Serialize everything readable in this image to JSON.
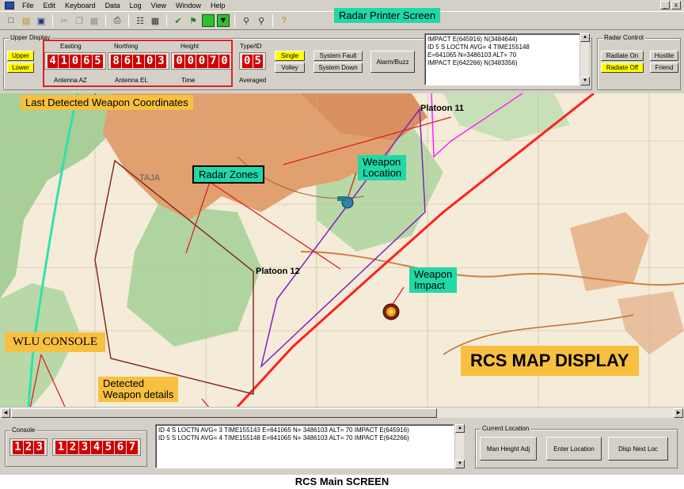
{
  "menu": [
    "File",
    "Edit",
    "Keyboard",
    "Data",
    "Log",
    "View",
    "Window",
    "Help"
  ],
  "window_buttons": [
    "_",
    "x"
  ],
  "toolbar_icons": [
    "new-file-icon",
    "open-folder-icon",
    "save-icon",
    "cut-icon",
    "copy-icon",
    "paste-icon",
    "print-icon",
    "page-icon",
    "calculator-icon",
    "checkmark-icon",
    "flag-icon",
    "map-icon",
    "grid-icon",
    "zoom-in-icon",
    "zoom-out-icon",
    "help-icon"
  ],
  "upper_display": {
    "title": "Upper Display",
    "upper_label": "Upper",
    "lower_label": "Lower",
    "easting_label": "Easting",
    "northing_label": "Northing",
    "height_label": "Height",
    "typeid_label": "Type/ID",
    "easting": [
      "4",
      "1",
      "0",
      "6",
      "5"
    ],
    "northing": [
      "8",
      "6",
      "1",
      "0",
      "3"
    ],
    "height": [
      "0",
      "0",
      "0",
      "7",
      "0"
    ],
    "typeid": [
      "0",
      "5"
    ],
    "antenna_az_label": "Antenna AZ",
    "antenna_el_label": "Antenna EL",
    "time_label": "Time",
    "averaged_label": "Averaged",
    "single_label": "Single",
    "volley_label": "Volley",
    "system_fault_label": "System Fault",
    "system_down_label": "System Down",
    "alarm_label": "Alarm/Buzz"
  },
  "printer": {
    "lines": [
      "IMPACT  E(645916) N(3484644)",
      "ID 5  S LOCTN AVG= 4  TIME155148",
      "E=641065  N=3486103  ALT=  70",
      "IMPACT  E(642266) N(3483356)"
    ]
  },
  "radar_control": {
    "title": "Radar Control",
    "radiate_on": "Radiate On",
    "radiate_off": "Radiate Off",
    "hostile": "Hostile",
    "friend": "Friend"
  },
  "map": {
    "grid_label": "TAJA",
    "platoon_11": "Platoon 11",
    "platoon_12": "Platoon 12"
  },
  "callouts": {
    "radar_printer": "Radar Printer Screen",
    "last_detected": "Last Detected Weapon Coordinates",
    "radar_zones": "Radar Zones",
    "weapon_location_1": "Weapon",
    "weapon_location_2": "Location",
    "weapon_impact_1": "Weapon",
    "weapon_impact_2": "Impact",
    "wlu_console": "WLU CONSOLE",
    "detected_1": "Detected",
    "detected_2": "Weapon details",
    "rcs_map": "RCS MAP DISPLAY"
  },
  "console": {
    "title": "Console",
    "short": [
      "1",
      "2",
      "3"
    ],
    "long": [
      "1",
      "2",
      "3",
      "4",
      "5",
      "6",
      "7"
    ]
  },
  "details": {
    "lines": [
      "ID 4 S LOCTN AVG= 3  TIME155143 E=641065  N= 3486103  ALT= 70  IMPACT E(645916)",
      "ID 5 S LOCTN AVG= 4  TIME155148 E=641065  N= 3486103  ALT= 70  IMPACT E(642266)"
    ]
  },
  "current_location": {
    "title": "Current Location",
    "man_height": "Man Height Adj",
    "enter_location": "Enter Location",
    "disp_next": "Disp Next Loc"
  },
  "caption": "RCS Main SCREEN",
  "colors": {
    "led_red": "#d00000",
    "panel_gray": "#d4d0c8",
    "callout_green": "#20d8a8",
    "callout_orange": "#f8c040",
    "highlight_yellow": "#ffff00"
  }
}
